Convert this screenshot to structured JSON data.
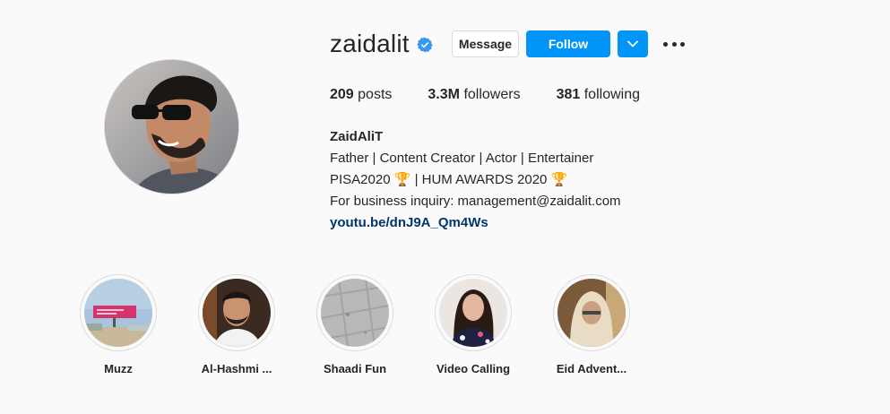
{
  "profile": {
    "username": "zaidalit",
    "verified_icon": "verified-badge-icon",
    "message_label": "Message",
    "follow_label": "Follow",
    "dropdown_icon": "chevron-down-icon",
    "more_icon": "more-options-icon",
    "accent_color": "#0095f6"
  },
  "stats": {
    "posts_count": "209",
    "posts_label": "posts",
    "followers_count": "3.3M",
    "followers_label": "followers",
    "following_count": "381",
    "following_label": "following"
  },
  "bio": {
    "full_name": "ZaidAliT",
    "line1": "Father | Content Creator | Actor | Entertainer",
    "line2": "PISA2020 🏆 | HUM AWARDS 2020 🏆",
    "line3": "For business inquiry: management@zaidalit.com",
    "link": "youtu.be/dnJ9A_Qm4Ws"
  },
  "highlights": [
    {
      "label": "Muzz"
    },
    {
      "label": "Al-Hashmi ..."
    },
    {
      "label": "Shaadi Fun"
    },
    {
      "label": "Video Calling"
    },
    {
      "label": "Eid Advent..."
    }
  ]
}
